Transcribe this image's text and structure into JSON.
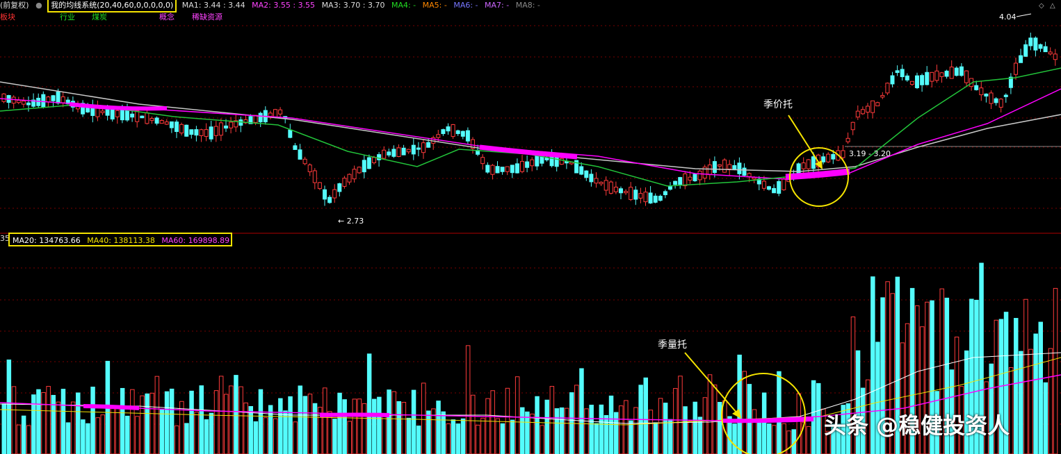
{
  "header": {
    "left_text": "(前复权)",
    "indicator_name": "我的均线系统(20,40,60,0,0,0,0,0)",
    "ma_items": [
      {
        "label": "MA1: 3.44 : 3.44",
        "color": "#dddddd"
      },
      {
        "label": "MA2: 3.55 : 3.55",
        "color": "#ff44ff"
      },
      {
        "label": "MA3: 3.70 : 3.70",
        "color": "#dddddd"
      },
      {
        "label": "MA4: -",
        "color": "#22dd22"
      },
      {
        "label": "MA5: -",
        "color": "#ff8800"
      },
      {
        "label": "MA6: -",
        "color": "#7777ff"
      },
      {
        "label": "MA7: -",
        "color": "#cc66ff"
      },
      {
        "label": "MA8: -",
        "color": "#888888"
      }
    ]
  },
  "sector_row": {
    "plate": "板块",
    "industry": "行业",
    "industry_value": "煤炭",
    "concept": "概念",
    "concept_value": "稀缺资源"
  },
  "price_panel": {
    "high_label": "4.04",
    "low_label": "2.73",
    "range_label": "3.19 - 3.20",
    "annotation": "季价托"
  },
  "volume_panel": {
    "left_label": "35",
    "ma20": "MA20: 134763.66",
    "ma40": "MA40: 138113.38",
    "ma60": "MA60: 169898.89",
    "annotation": "季量托"
  },
  "watermark": "头条 @稳健投资人",
  "colors": {
    "up": "#ff3b3b",
    "down": "#54fcfc",
    "ma20": "#22c43a",
    "ma40": "#ff00ff",
    "ma60": "#c8c8c8",
    "highlight": "#f5e400"
  }
}
